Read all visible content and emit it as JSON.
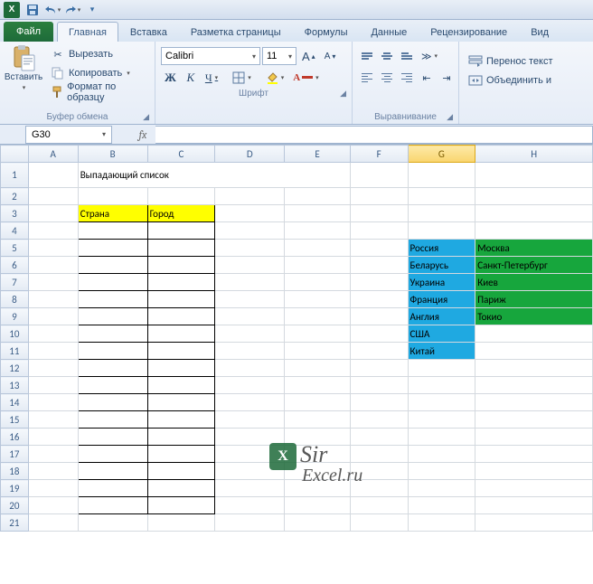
{
  "qat": {
    "app_initial": "X"
  },
  "tabs": {
    "file": "Файл",
    "items": [
      "Главная",
      "Вставка",
      "Разметка страницы",
      "Формулы",
      "Данные",
      "Рецензирование",
      "Вид"
    ],
    "active_index": 0
  },
  "ribbon": {
    "clipboard": {
      "paste": "Вставить",
      "cut": "Вырезать",
      "copy": "Копировать",
      "format_painter": "Формат по образцу",
      "label": "Буфер обмена"
    },
    "font": {
      "name": "Calibri",
      "size": "11",
      "bold": "Ж",
      "italic": "К",
      "underline": "Ч",
      "increase": "A",
      "decrease": "A",
      "label": "Шрифт"
    },
    "alignment": {
      "wrap": "Перенос текст",
      "merge": "Объединить и",
      "label": "Выравнивание"
    }
  },
  "namebox": {
    "ref": "G30"
  },
  "formula_bar": {
    "fx": "fx",
    "value": ""
  },
  "columns": [
    "A",
    "B",
    "C",
    "D",
    "E",
    "F",
    "G",
    "H"
  ],
  "selected_column": "G",
  "row_count": 21,
  "content": {
    "title": "Выпадающий список",
    "header_country": "Страна",
    "header_city": "Город",
    "countries": [
      "Россия",
      "Беларусь",
      "Украина",
      "Франция",
      "Англия",
      "США",
      "Китай"
    ],
    "cities": [
      "Москва",
      "Санкт-Петербург",
      "Киев",
      "Париж",
      "Токио"
    ]
  },
  "watermark": {
    "line1": "Sir",
    "line2": "Excel.ru",
    "logo": "X"
  },
  "colors": {
    "yellow": "#ffff00",
    "blue": "#1fa9e1",
    "green": "#17a63d",
    "accent": "#1e6b3a"
  }
}
